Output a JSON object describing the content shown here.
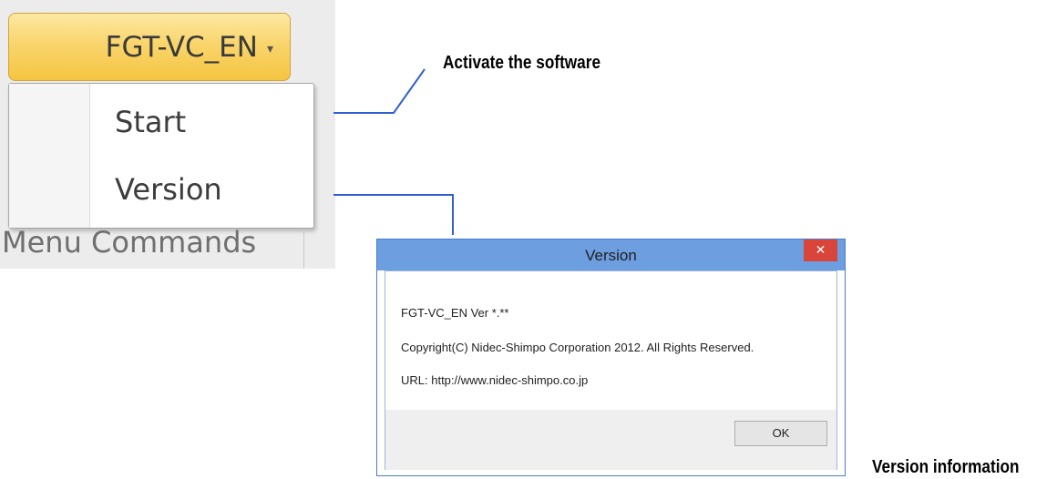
{
  "ribbon": {
    "dropdown_label": "FGT-VC_EN",
    "dropdown_caret": "▾",
    "menu_items": [
      {
        "label": "Start"
      },
      {
        "label": "Version"
      }
    ],
    "group_label": "Menu Commands"
  },
  "callouts": {
    "activate": "Activate the software",
    "version_info": "Version information"
  },
  "dialog": {
    "title": "Version",
    "close_glyph": "✕",
    "lines": [
      "FGT-VC_EN Ver *.**",
      "Copyright(C) Nidec-Shimpo Corporation 2012. All Rights Reserved.",
      "URL: http://www.nidec-shimpo.co.jp"
    ],
    "ok_label": "OK"
  },
  "colors": {
    "ribbon_accent": "#f5c542",
    "callout_line": "#2f5fd0",
    "titlebar": "#6c9ee0",
    "close_button": "#d9443b"
  }
}
